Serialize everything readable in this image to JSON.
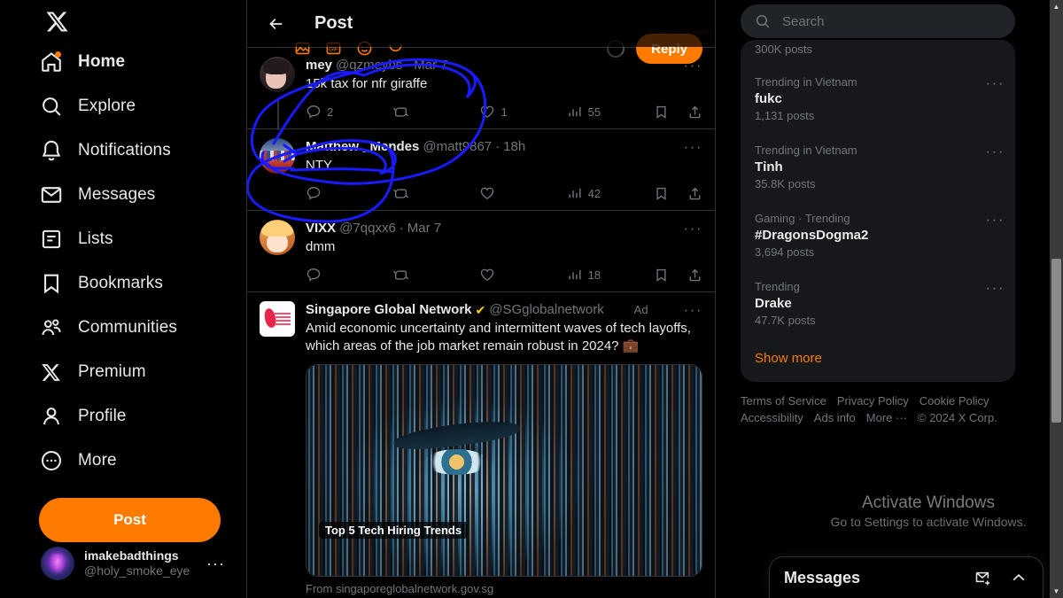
{
  "sidebar": {
    "logo_icon": "x-logo-icon",
    "items": [
      {
        "label": "Home",
        "icon": "home-icon",
        "badge": true
      },
      {
        "label": "Explore",
        "icon": "search-icon",
        "badge": false
      },
      {
        "label": "Notifications",
        "icon": "bell-icon",
        "badge": false
      },
      {
        "label": "Messages",
        "icon": "envelope-icon",
        "badge": false
      },
      {
        "label": "Lists",
        "icon": "list-icon",
        "badge": false
      },
      {
        "label": "Bookmarks",
        "icon": "bookmark-icon",
        "badge": false
      },
      {
        "label": "Communities",
        "icon": "communities-icon",
        "badge": false
      },
      {
        "label": "Premium",
        "icon": "x-premium-icon",
        "badge": false
      },
      {
        "label": "Profile",
        "icon": "person-icon",
        "badge": false
      },
      {
        "label": "More",
        "icon": "more-circle-icon",
        "badge": false
      }
    ],
    "post_button": "Post",
    "account": {
      "name": "imakebadthings",
      "handle": "@holy_smoke_eye",
      "more": "···"
    }
  },
  "center": {
    "back_icon": "back-arrow-icon",
    "title": "Post",
    "compose": {
      "tools": [
        "media-icon",
        "gif-icon",
        "emoji-icon",
        "poll-icon"
      ],
      "reply_button": "Reply"
    },
    "posts": [
      {
        "avatar": "av-mey",
        "name": "mey",
        "handle": "@qzmeybs",
        "separator": "·",
        "time": "Mar 7",
        "text": "15k tax for nfr giraffe",
        "more": "···",
        "replies": "2",
        "reposts": "",
        "likes": "1",
        "views": "55",
        "thread": true
      },
      {
        "avatar": "av-matt",
        "name": "Matthew _Mendes",
        "handle": "@matt9867",
        "separator": "·",
        "time": "18h",
        "text": "NTY",
        "more": "···",
        "replies": "",
        "reposts": "",
        "likes": "",
        "views": "42",
        "thread": false
      },
      {
        "avatar": "av-vixx",
        "name": "VIXX",
        "handle": "@7qqxx6",
        "separator": "·",
        "time": "Mar 7",
        "text": "dmm",
        "more": "···",
        "replies": "",
        "reposts": "",
        "likes": "",
        "views": "18",
        "thread": false
      }
    ],
    "ad": {
      "avatar": "av-sq",
      "name": "Singapore Global Network",
      "verified_icon": "verified-badge-icon",
      "handle": "@SGglobalnetwork",
      "ad_label": "Ad",
      "more": "···",
      "text": "Amid economic uncertainty and intermittent waves of tech layoffs, which areas of the job market remain robust in 2024? 💼",
      "image_badge": "Top 5 Tech Hiring Trends",
      "from": "From singaporeglobalnetwork.gov.sg"
    }
  },
  "right": {
    "search": {
      "icon": "search-icon",
      "placeholder": "Search",
      "value": ""
    },
    "trend_partial": {
      "count": "300K posts"
    },
    "trends": [
      {
        "category": "Trending in Vietnam",
        "name": "fukc",
        "count": "1,131 posts",
        "more": "···"
      },
      {
        "category": "Trending in Vietnam",
        "name": "Tỉnh",
        "count": "35.8K posts",
        "more": "···"
      },
      {
        "category": "Gaming · Trending",
        "name": "#DragonsDogma2",
        "count": "3,694 posts",
        "more": "···"
      },
      {
        "category": "Trending",
        "name": "Drake",
        "count": "47.7K posts",
        "more": "···"
      }
    ],
    "show_more": "Show more",
    "footer": [
      "Terms of Service",
      "Privacy Policy",
      "Cookie Policy",
      "Accessibility",
      "Ads info",
      "More ···",
      "© 2024 X Corp."
    ]
  },
  "watermark": {
    "title": "Activate Windows",
    "subtitle": "Go to Settings to activate Windows."
  },
  "messages_dock": {
    "title": "Messages",
    "new_message_icon": "new-message-icon",
    "expand_icon": "chevron-up-icon"
  },
  "colors": {
    "accent": "#ff7a00",
    "background": "#000000",
    "panel": "#16181c",
    "muted_text": "#71767b",
    "border": "#2f3336",
    "annotation": "#1a1aff"
  },
  "annotation": {
    "color": "#1a1aff",
    "shape": "hand-drawn-circles"
  }
}
